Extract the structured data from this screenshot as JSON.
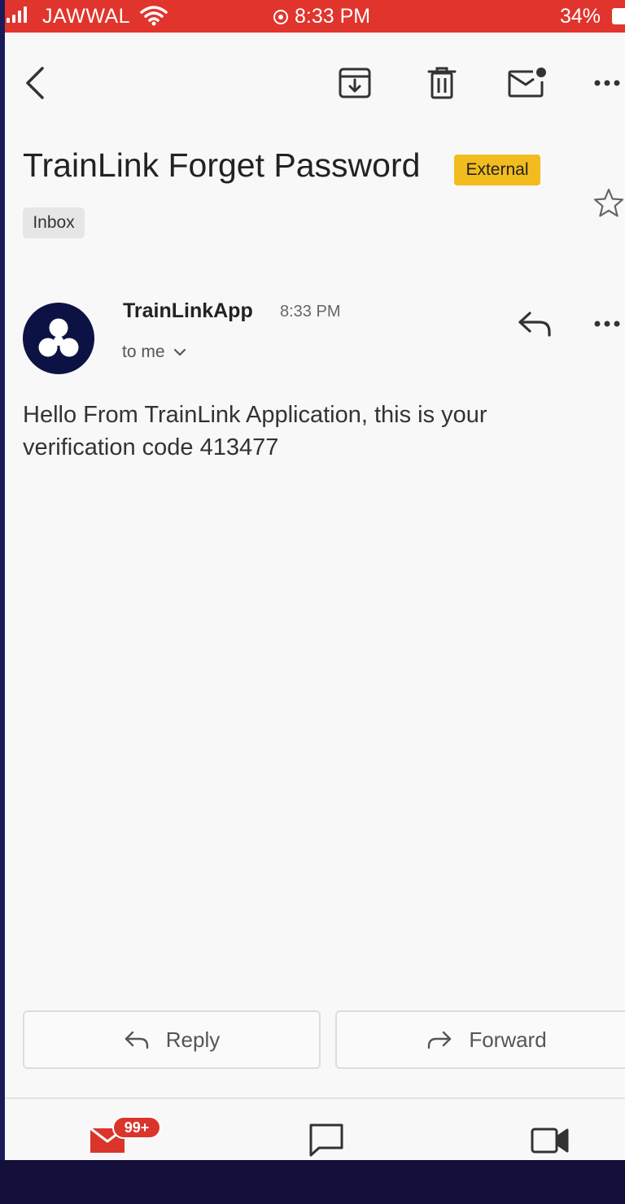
{
  "status_bar": {
    "carrier": "JAWWAL",
    "time": "8:33 PM",
    "battery": "34%"
  },
  "toolbar": {
    "icons": [
      "back-arrow-icon",
      "archive-icon",
      "trash-icon",
      "mark-unread-icon",
      "more-icon"
    ]
  },
  "email": {
    "subject": "TrainLink Forget Password",
    "external_label": "External",
    "folder_label": "Inbox",
    "sender": "TrainLinkApp",
    "time": "8:33 PM",
    "recipient": "to me",
    "body": "Hello From TrainLink Application, this is your verification code 413477"
  },
  "actions": {
    "reply_label": "Reply",
    "forward_label": "Forward"
  },
  "bottom_nav": {
    "mail_badge": "99+",
    "items": [
      "mail-icon",
      "chat-icon",
      "meet-icon"
    ]
  },
  "colors": {
    "status_bar": "#e0342c",
    "external_badge": "#f2bb1e",
    "avatar": "#0d1244",
    "mail_red": "#d9352b"
  }
}
